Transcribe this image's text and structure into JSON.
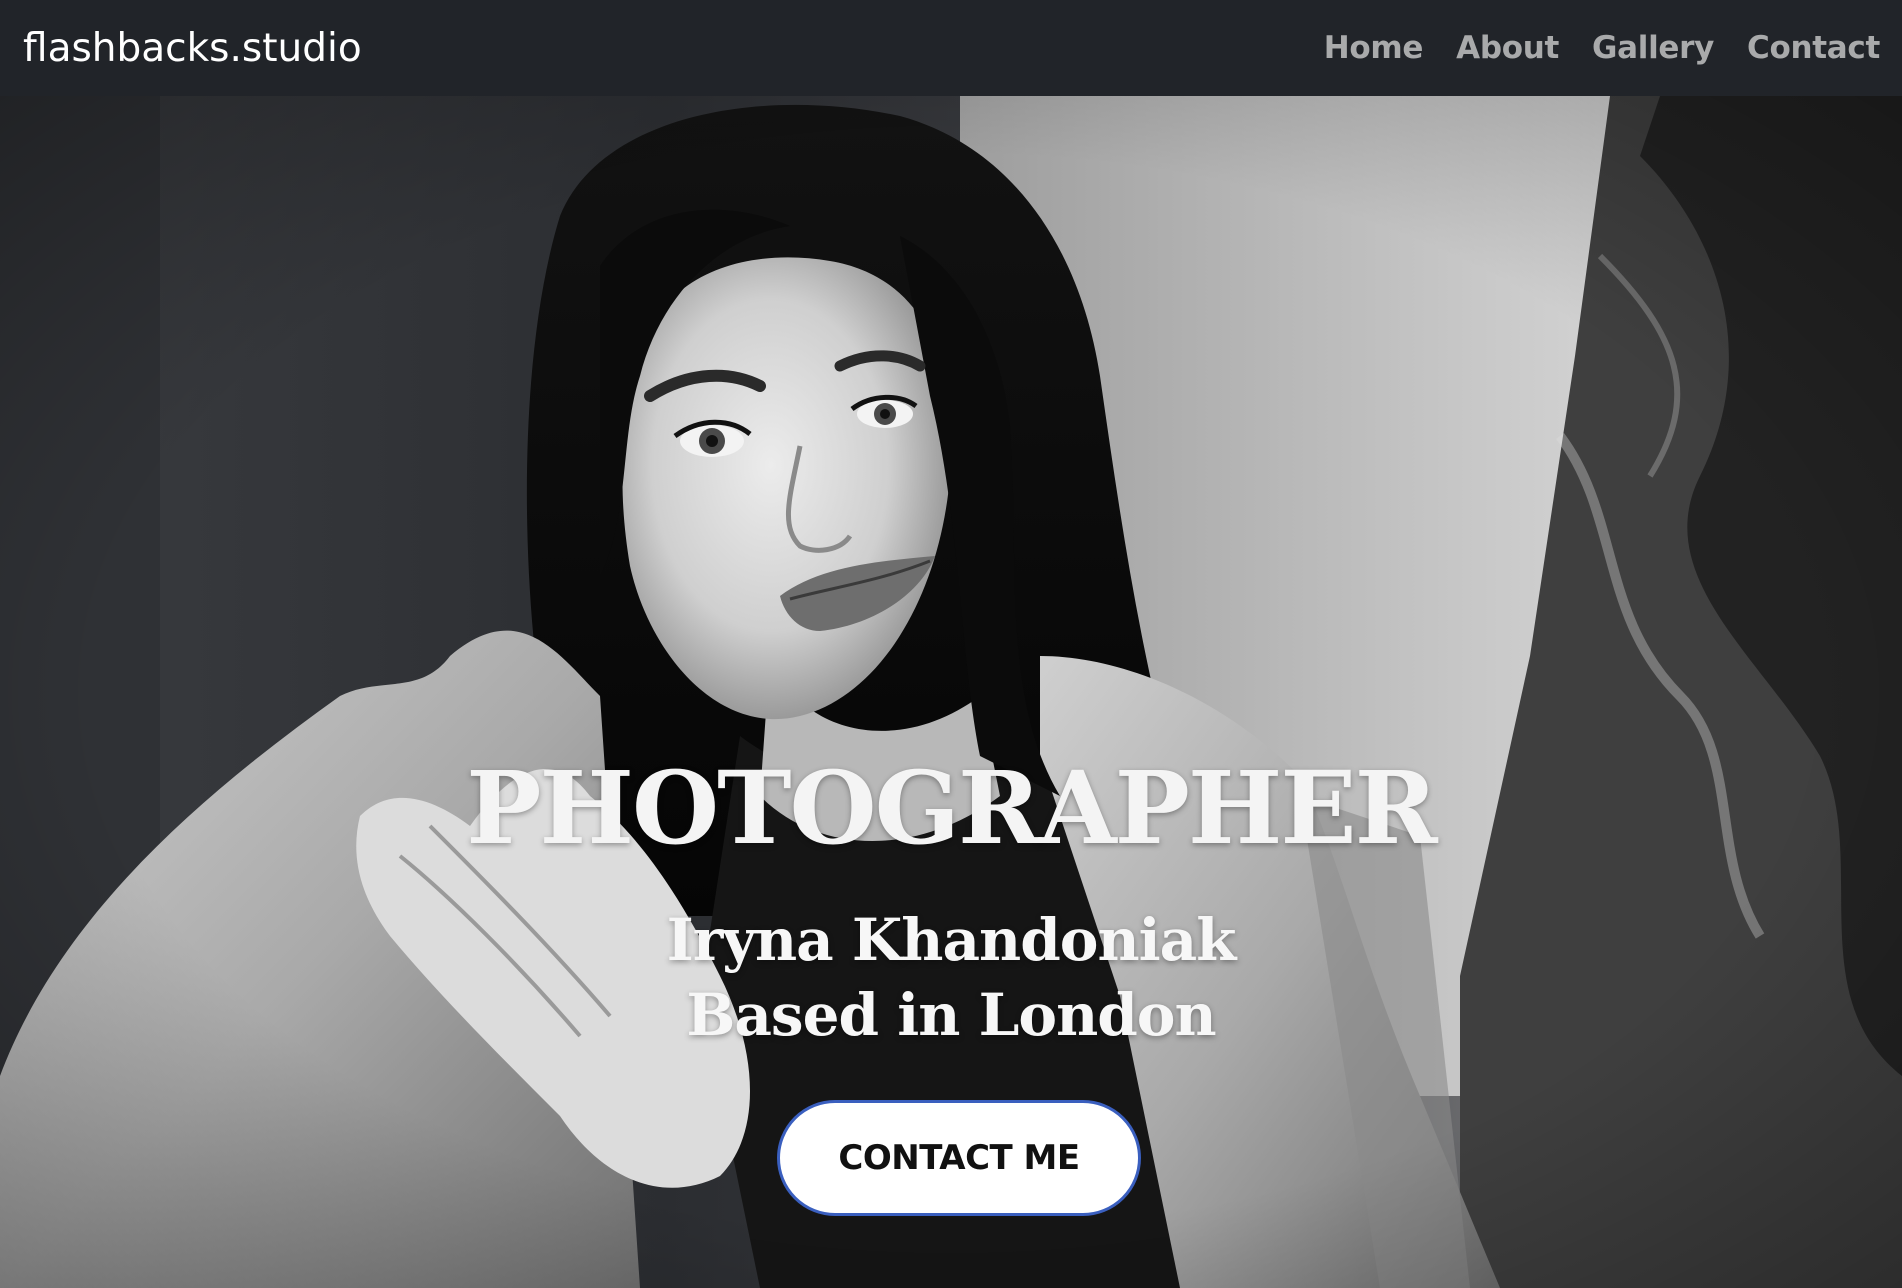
{
  "nav": {
    "brand": "flashbacks.studio",
    "links": [
      {
        "label": "Home"
      },
      {
        "label": "About"
      },
      {
        "label": "Gallery"
      },
      {
        "label": "Contact"
      }
    ]
  },
  "hero": {
    "headline": "PHOTOGRAPHER",
    "name_line": "Iryna Khandoniak",
    "location_line": "Based in London",
    "cta_label": "CONTACT ME"
  },
  "colors": {
    "navbar_bg": "#212429",
    "nav_link": "#a9aaab",
    "brand_text": "#ffffff",
    "cta_border": "#3a5fbf"
  }
}
